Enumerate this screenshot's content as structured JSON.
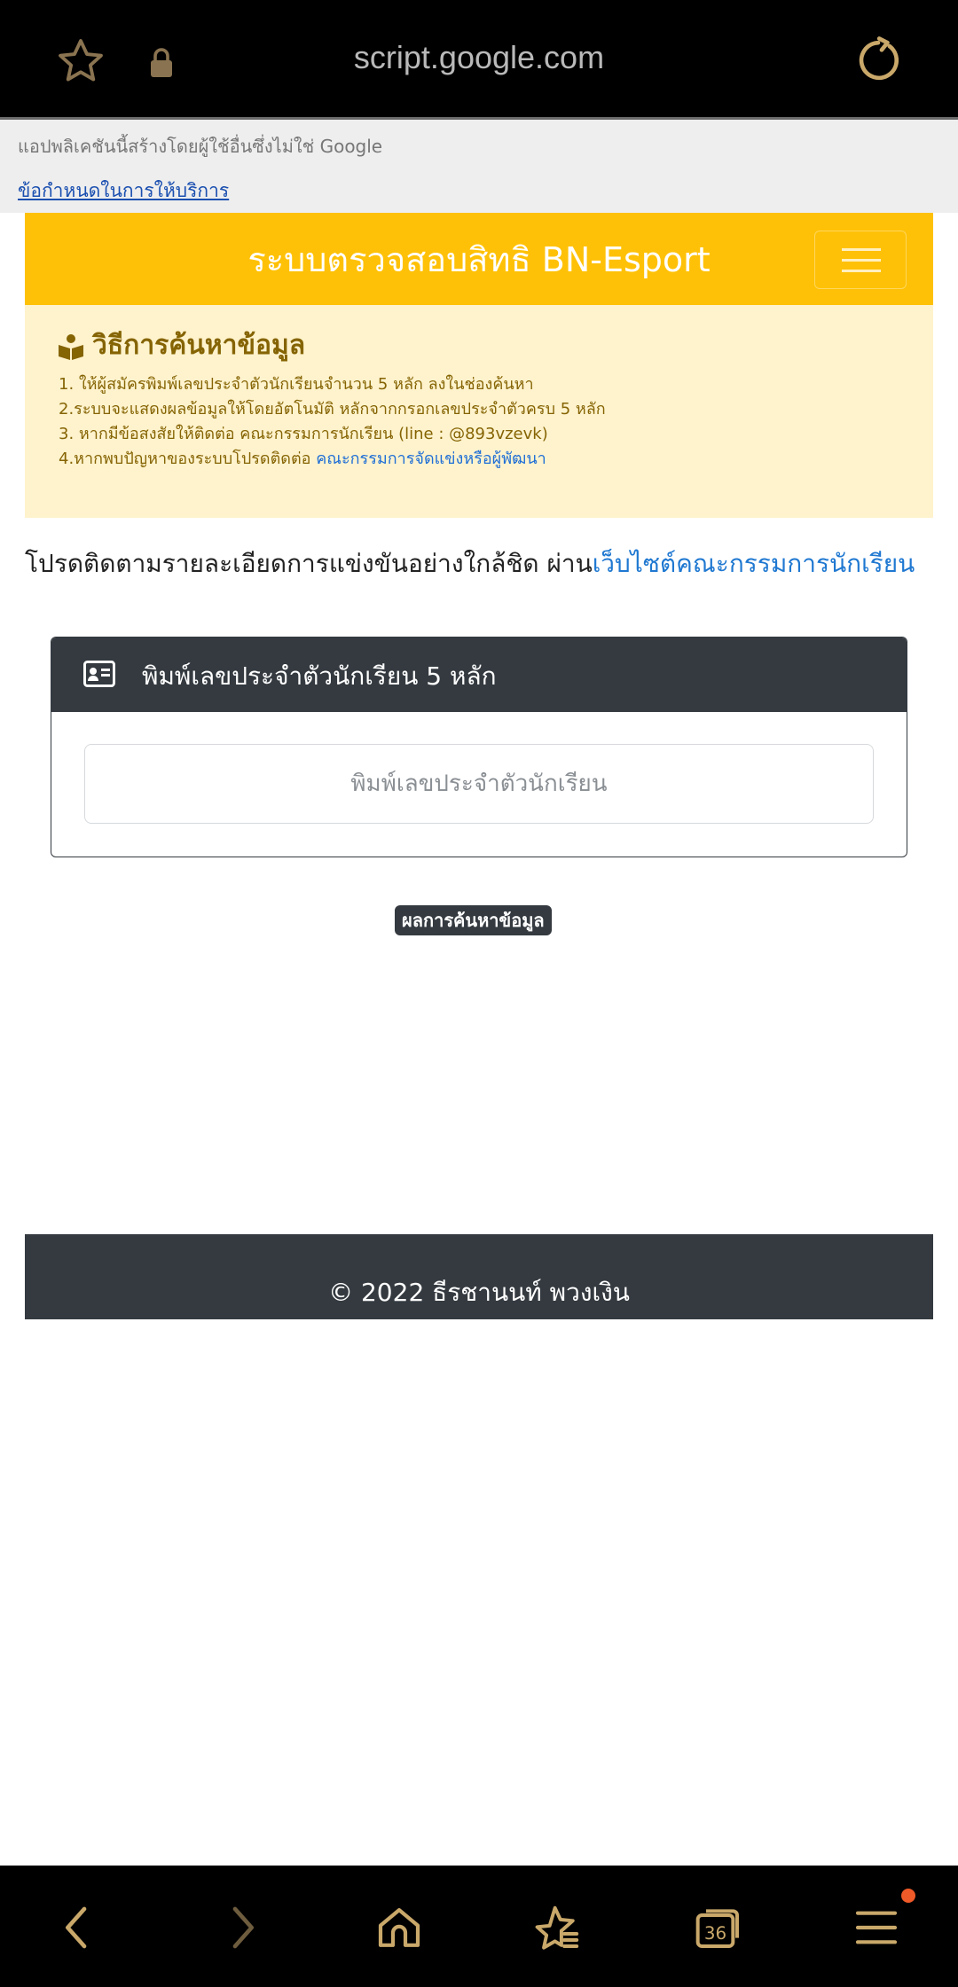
{
  "browser": {
    "url": "script.google.com",
    "tab_count": "36"
  },
  "notice": {
    "message": "แอปพลิเคชันนี้สร้างโดยผู้ใช้อื่นซึ่งไม่ใช่ Google",
    "terms_link": "ข้อกำหนดในการให้บริการ"
  },
  "navbar": {
    "brand": "ระบบตรวจสอบสิทธิ BN-Esport"
  },
  "alert": {
    "title": "วิธีการค้นหาข้อมูล",
    "steps": [
      "1. ให้ผู้สมัครพิมพ์เลขประจำตัวนักเรียนจำนวน 5 หลัก ลงในช่องค้นหา",
      "2.ระบบจะแสดงผลข้อมูลให้โดยอัตโนมัติ หลักจากกรอกเลขประจำตัวครบ 5 หลัก",
      "3. หากมีข้อสงสัยให้ติดต่อ คณะกรรมการนักเรียน (line : @893vzevk)",
      "4.หากพบปัญหาของระบบโปรดติดต่อ "
    ],
    "step4_link": "คณะกรรมการจัดแข่งหรือผู้พัฒนา"
  },
  "follow": {
    "text": "โปรดติดตามรายละเอียดการแข่งขันอย่างใกล้ชิด ผ่าน",
    "link": "เว็บไซต์คณะกรรมการนักเรียน"
  },
  "search_card": {
    "header": "พิมพ์เลขประจำตัวนักเรียน 5 หลัก",
    "input_placeholder": "พิมพ์เลขประจำตัวนักเรียน",
    "input_value": ""
  },
  "results": {
    "badge": "ผลการค้นหาข้อมูล"
  },
  "footer": {
    "copyright": "© 2022 ธีรชานนท์ พวงเงิน"
  },
  "colors": {
    "navbar": "#ffc107",
    "alert_bg": "#fff3cd",
    "alert_text": "#856404",
    "dark": "#343a40",
    "link": "#1f78d1",
    "browser_icon": "#c9a86a"
  },
  "icons": [
    "star-icon",
    "lock-icon",
    "reload-icon",
    "book-reader-icon",
    "id-card-icon",
    "back-icon",
    "forward-icon",
    "home-icon",
    "bookmarks-icon",
    "tabs-icon",
    "menu-icon"
  ]
}
